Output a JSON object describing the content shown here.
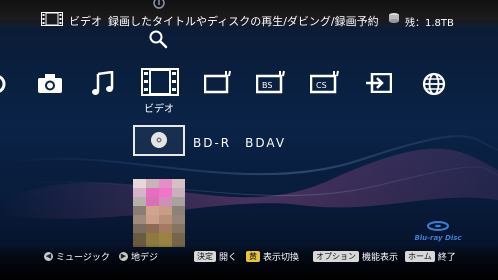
{
  "header": {
    "title": "ビデオ",
    "description": "録画したタイトルやディスクの再生/ダビング/録画予約",
    "remaining": "残：1.8TB"
  },
  "categories": [
    {
      "icon": "gear-icon"
    },
    {
      "icon": "camera-icon"
    },
    {
      "icon": "music-note-icon"
    },
    {
      "icon": "film-icon",
      "label": "ビデオ",
      "selected": true
    },
    {
      "icon": "bd-tv-icon"
    },
    {
      "icon": "bs-icon",
      "text": "BS"
    },
    {
      "icon": "cs-icon",
      "text": "CS"
    },
    {
      "icon": "input-icon"
    },
    {
      "icon": "globe-icon"
    }
  ],
  "content": {
    "disc_label": "BD-R　BDAV"
  },
  "brand": {
    "logo_text": "Blu-ray Disc"
  },
  "footer": {
    "left_label": "ミュージック",
    "right_label": "地デジ",
    "decide_key": "決定",
    "decide_action": "開く",
    "yellow_key": "黄",
    "yellow_action": "表示切換",
    "option_key": "オプション",
    "option_action": "機能表示",
    "home_key": "ホーム",
    "home_action": "終了"
  },
  "colors": {
    "accent_yellow": "#e7c53a",
    "background": "#0a2347",
    "wave_pink": "#c05aa0"
  }
}
